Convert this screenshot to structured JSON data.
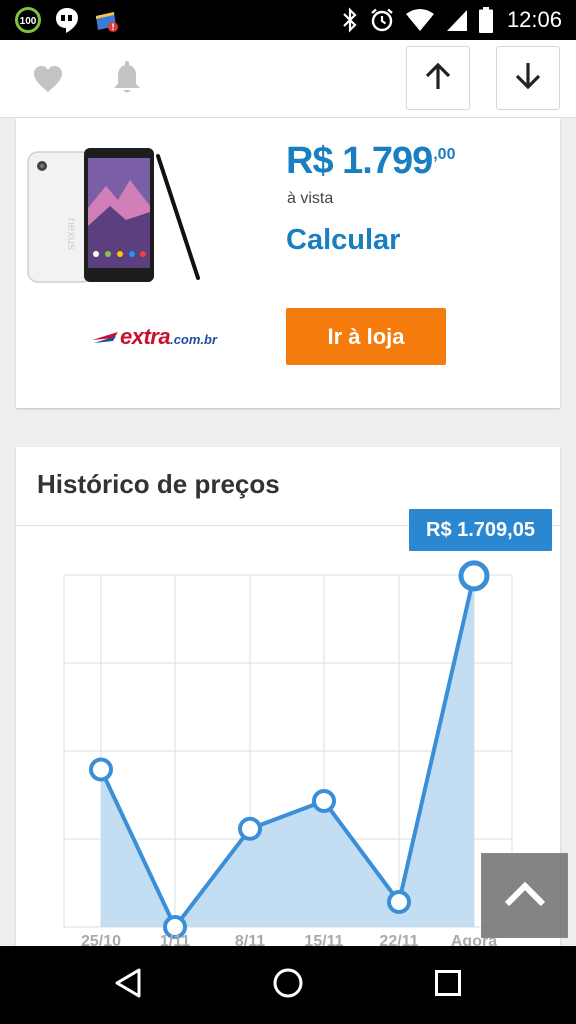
{
  "status_bar": {
    "time": "12:06",
    "battery_ring_label": "100",
    "icons": [
      "battery-ring-icon",
      "hangouts-icon",
      "shopping-bag-notification-icon",
      "bluetooth-icon",
      "alarm-clock-icon",
      "wifi-icon",
      "cell-signal-icon",
      "battery-icon"
    ]
  },
  "toolbar": {
    "icons": [
      "heart-icon",
      "bell-icon",
      "arrow-up-icon",
      "arrow-down-icon"
    ]
  },
  "offer": {
    "price_main": "R$ 1.799",
    "price_cents": ",00",
    "price_note": "à vista",
    "calculate_label": "Calcular",
    "store_button_label": "Ir à loja",
    "store_logo_main": "extra",
    "store_logo_sub": ".com.br",
    "colors": {
      "price": "#1a7fc1",
      "button": "#f47b0c",
      "logo_red": "#c8102e",
      "logo_blue": "#1e4fa0"
    }
  },
  "history": {
    "title": "Histórico de preços",
    "tooltip_value": "R$ 1.709,05"
  },
  "chart_data": {
    "type": "area",
    "categories": [
      "25/10",
      "1/11",
      "8/11",
      "15/11",
      "22/11",
      "Agora"
    ],
    "values": [
      1500,
      1330,
      1436,
      1466,
      1357,
      1709.05
    ],
    "ylim": [
      1330,
      1710
    ],
    "grid": true,
    "highlighted_label": "R$ 1.709,05",
    "colors": {
      "line": "#3b8fd8",
      "fill": "#bcd9f1",
      "point_fill": "#ffffff",
      "grid": "#dddddd",
      "tick": "#aaaaaa"
    }
  },
  "nav_bar": {
    "icons": [
      "back-triangle-icon",
      "home-circle-icon",
      "recent-apps-square-icon"
    ]
  },
  "floating": {
    "icon": "chevron-up-icon"
  }
}
